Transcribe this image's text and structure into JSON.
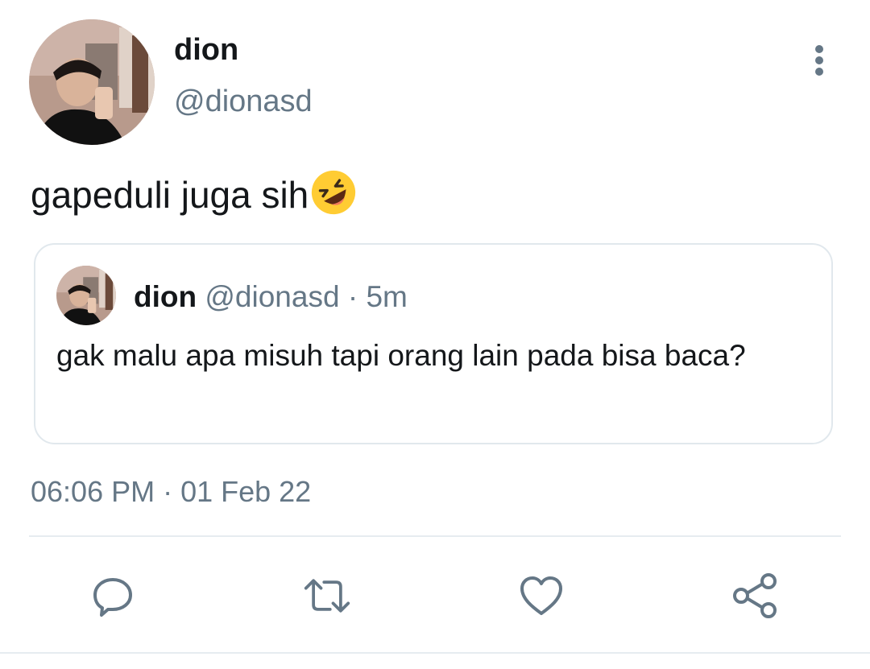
{
  "tweet": {
    "author": {
      "display_name": "dion",
      "handle": "@dionasd"
    },
    "text": "gapeduli juga sih",
    "emoji": "rolling-on-the-floor-laughing-emoji",
    "timestamp": "06:06 PM · 01 Feb 22"
  },
  "quoted_tweet": {
    "display_name": "dion",
    "handle": "@dionasd",
    "separator": " · ",
    "age": "5m",
    "text": "gak malu apa misuh tapi orang lain pada bisa baca?"
  },
  "actions": {
    "icons": [
      "reply-icon",
      "retweet-icon",
      "like-icon",
      "share-icon"
    ]
  },
  "colors": {
    "text": "#14171a",
    "secondary": "#657786",
    "border": "#e1e8ed",
    "icon": "#657786"
  }
}
